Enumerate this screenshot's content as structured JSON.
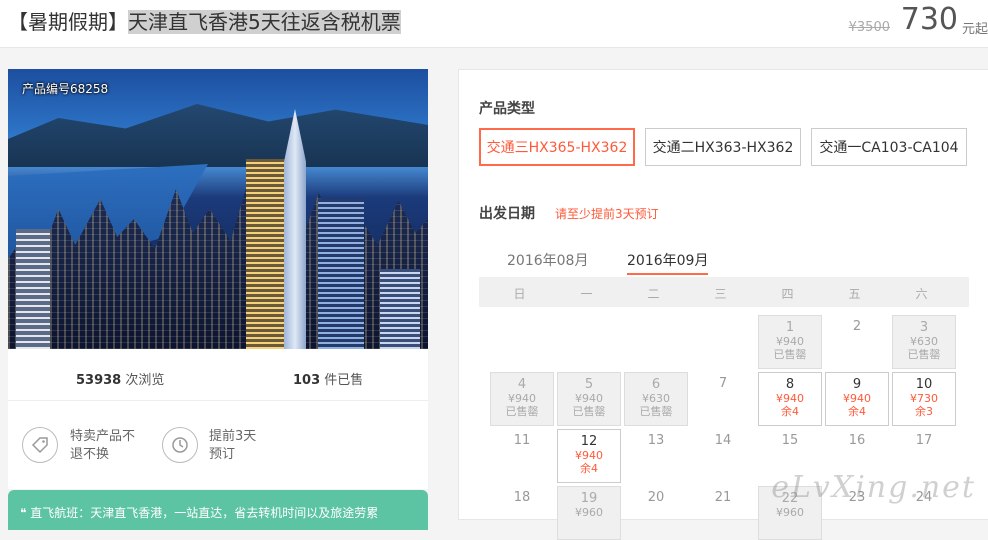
{
  "header": {
    "title_prefix": "【暑期假期】",
    "title_main": "天津直飞香港5天往返含税机票",
    "original_price": "¥3500",
    "price": "730",
    "price_unit": "元起"
  },
  "product": {
    "code_label": "产品编号68258",
    "views_count": "53938",
    "views_label": "次浏览",
    "sold_count": "103",
    "sold_label": "件已售",
    "features": [
      {
        "icon": "tag-icon",
        "text": "特卖产品不退不换"
      },
      {
        "icon": "clock-icon",
        "text": "提前3天预订"
      }
    ],
    "highlight": "❝ 直飞航班：天津直飞香港，一站直达，省去转机时间以及旅途劳累"
  },
  "booking": {
    "type_label": "产品类型",
    "types": [
      "交通三HX365-HX362",
      "交通二HX363-HX362",
      "交通一CA103-CA104"
    ],
    "selected_type": 0,
    "date_label": "出发日期",
    "date_note": "请至少提前3天预订",
    "months": [
      "2016年08月",
      "2016年09月"
    ],
    "weekdays": [
      "日",
      "一",
      "二",
      "三",
      "四",
      "五",
      "六"
    ],
    "days": [
      {
        "d": "1",
        "p": "¥940",
        "s": "已售罄",
        "st": "sold",
        "col": 4,
        "row": 0
      },
      {
        "d": "2",
        "p": "",
        "s": "",
        "st": "none",
        "col": 5,
        "row": 0
      },
      {
        "d": "3",
        "p": "¥630",
        "s": "已售罄",
        "st": "sold",
        "col": 6,
        "row": 0
      },
      {
        "d": "4",
        "p": "¥940",
        "s": "已售罄",
        "st": "sold",
        "col": 0,
        "row": 1
      },
      {
        "d": "5",
        "p": "¥940",
        "s": "已售罄",
        "st": "sold",
        "col": 1,
        "row": 1
      },
      {
        "d": "6",
        "p": "¥630",
        "s": "已售罄",
        "st": "sold",
        "col": 2,
        "row": 1
      },
      {
        "d": "7",
        "p": "",
        "s": "",
        "st": "none",
        "col": 3,
        "row": 1
      },
      {
        "d": "8",
        "p": "¥940",
        "s": "余4",
        "st": "avail",
        "col": 4,
        "row": 1
      },
      {
        "d": "9",
        "p": "¥940",
        "s": "余4",
        "st": "avail",
        "col": 5,
        "row": 1
      },
      {
        "d": "10",
        "p": "¥730",
        "s": "余3",
        "st": "avail",
        "col": 6,
        "row": 1
      },
      {
        "d": "11",
        "p": "",
        "s": "",
        "st": "none",
        "col": 0,
        "row": 2
      },
      {
        "d": "12",
        "p": "¥940",
        "s": "余4",
        "st": "avail",
        "col": 1,
        "row": 2
      },
      {
        "d": "13",
        "p": "",
        "s": "",
        "st": "none",
        "col": 2,
        "row": 2
      },
      {
        "d": "14",
        "p": "",
        "s": "",
        "st": "none",
        "col": 3,
        "row": 2
      },
      {
        "d": "15",
        "p": "",
        "s": "",
        "st": "none",
        "col": 4,
        "row": 2
      },
      {
        "d": "16",
        "p": "",
        "s": "",
        "st": "none",
        "col": 5,
        "row": 2
      },
      {
        "d": "17",
        "p": "",
        "s": "",
        "st": "none",
        "col": 6,
        "row": 2
      },
      {
        "d": "18",
        "p": "",
        "s": "",
        "st": "none",
        "col": 0,
        "row": 3
      },
      {
        "d": "19",
        "p": "¥960",
        "s": "",
        "st": "sold",
        "col": 1,
        "row": 3
      },
      {
        "d": "20",
        "p": "",
        "s": "",
        "st": "none",
        "col": 2,
        "row": 3
      },
      {
        "d": "21",
        "p": "",
        "s": "",
        "st": "none",
        "col": 3,
        "row": 3
      },
      {
        "d": "22",
        "p": "¥960",
        "s": "",
        "st": "sold",
        "col": 4,
        "row": 3
      },
      {
        "d": "23",
        "p": "",
        "s": "",
        "st": "none",
        "col": 5,
        "row": 3
      },
      {
        "d": "24",
        "p": "",
        "s": "",
        "st": "none",
        "col": 6,
        "row": 3
      }
    ]
  },
  "watermark": "eLvXing.net",
  "colors": {
    "accent": "#ff5a3a",
    "green": "#5cc4a2"
  }
}
